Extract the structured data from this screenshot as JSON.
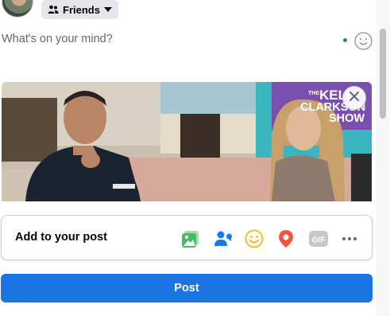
{
  "audience": {
    "label": "Friends",
    "icon": "friends-icon",
    "chevron": "caret-down-icon"
  },
  "composer": {
    "placeholder": "What's on your mind?"
  },
  "media": {
    "overlay_text": [
      "THE",
      "KELLY",
      "CLARKSON",
      "SHOW"
    ],
    "close_icon": "close-icon"
  },
  "add_to_post": {
    "label": "Add to your post",
    "icons": [
      "photo-video-icon",
      "tag-people-icon",
      "feeling-icon",
      "check-in-icon",
      "gif-icon",
      "more-icon"
    ],
    "gif_text": "GIF"
  },
  "post_button": {
    "label": "Post"
  },
  "colors": {
    "accent": "#1b74e4",
    "photo_green": "#45bd62",
    "tag_blue": "#1877f2",
    "feeling_yellow": "#f7b928",
    "checkin_red": "#f5533d",
    "gif_gray": "#c4c7cc"
  }
}
